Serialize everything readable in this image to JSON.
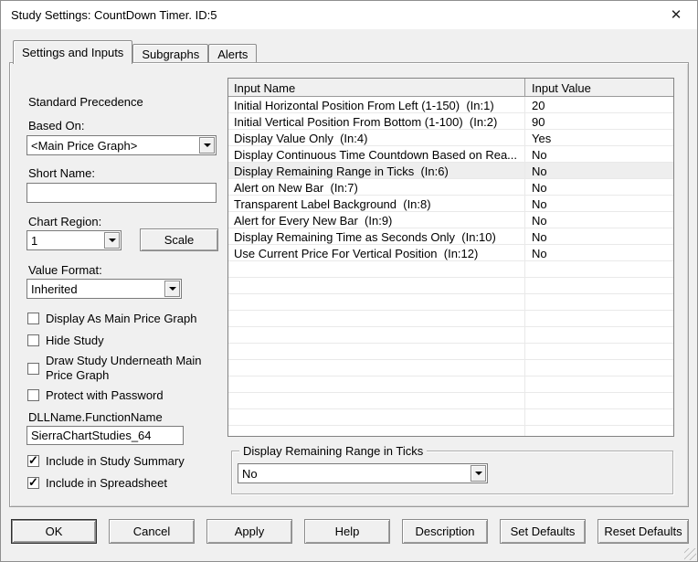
{
  "window": {
    "title": "Study Settings: CountDown Timer. ID:5",
    "close_glyph": "✕"
  },
  "tabs": [
    {
      "label": "Settings and Inputs",
      "active": true
    },
    {
      "label": "Subgraphs",
      "active": false
    },
    {
      "label": "Alerts",
      "active": false
    }
  ],
  "left_panel": {
    "precedence_label": "Standard Precedence",
    "based_on_label": "Based On:",
    "based_on_value": "<Main Price Graph>",
    "short_name_label": "Short Name:",
    "short_name_value": "",
    "chart_region_label": "Chart Region:",
    "chart_region_value": "1",
    "scale_button_label": "Scale",
    "value_format_label": "Value Format:",
    "value_format_value": "Inherited",
    "checkboxes": [
      {
        "label": "Display As Main Price Graph",
        "checked": false
      },
      {
        "label": "Hide Study",
        "checked": false
      },
      {
        "label": "Draw Study Underneath Main Price Graph",
        "checked": false
      },
      {
        "label": "Protect with Password",
        "checked": false
      }
    ],
    "dll_label": "DLLName.FunctionName",
    "dll_value": "SierraChartStudies_64",
    "summary_checkboxes": [
      {
        "label": "Include in Study Summary",
        "checked": true
      },
      {
        "label": "Include in Spreadsheet",
        "checked": true
      }
    ]
  },
  "inputs_table": {
    "columns": [
      "Input Name",
      "Input Value"
    ],
    "rows": [
      {
        "name": "Initial Horizontal Position From Left (1-150)  (In:1)",
        "value": "20",
        "selected": false
      },
      {
        "name": "Initial Vertical Position From Bottom (1-100)  (In:2)",
        "value": "90",
        "selected": false
      },
      {
        "name": "Display Value Only  (In:4)",
        "value": "Yes",
        "selected": false
      },
      {
        "name": "Display Continuous Time Countdown Based on Rea...",
        "value": "No",
        "selected": false
      },
      {
        "name": "Display Remaining Range in Ticks  (In:6)",
        "value": "No",
        "selected": true
      },
      {
        "name": "Alert on New Bar  (In:7)",
        "value": "No",
        "selected": false
      },
      {
        "name": "Transparent Label Background  (In:8)",
        "value": "No",
        "selected": false
      },
      {
        "name": "Alert for Every New Bar  (In:9)",
        "value": "No",
        "selected": false
      },
      {
        "name": "Display Remaining Time as Seconds Only  (In:10)",
        "value": "No",
        "selected": false
      },
      {
        "name": "Use Current Price For Vertical Position  (In:12)",
        "value": "No",
        "selected": false
      }
    ]
  },
  "input_editor": {
    "group_label": "Display Remaining Range in Ticks",
    "dropdown_value": "No"
  },
  "buttons": [
    {
      "label": "OK",
      "default": true
    },
    {
      "label": "Cancel",
      "default": false
    },
    {
      "label": "Apply",
      "default": false
    },
    {
      "label": "Help",
      "default": false
    },
    {
      "label": "Description",
      "default": false
    },
    {
      "label": "Set Defaults",
      "default": false
    },
    {
      "label": "Reset Defaults",
      "default": false
    }
  ],
  "colors": {
    "titlebar_bg": "#ffffff",
    "dialog_bg": "#f0f0f0",
    "table_bg": "#ffffff",
    "selected_row_bg": "#eeeeee",
    "border_dark": "#7b7b7b",
    "grid_line": "#e9e9e9",
    "text": "#000000"
  }
}
